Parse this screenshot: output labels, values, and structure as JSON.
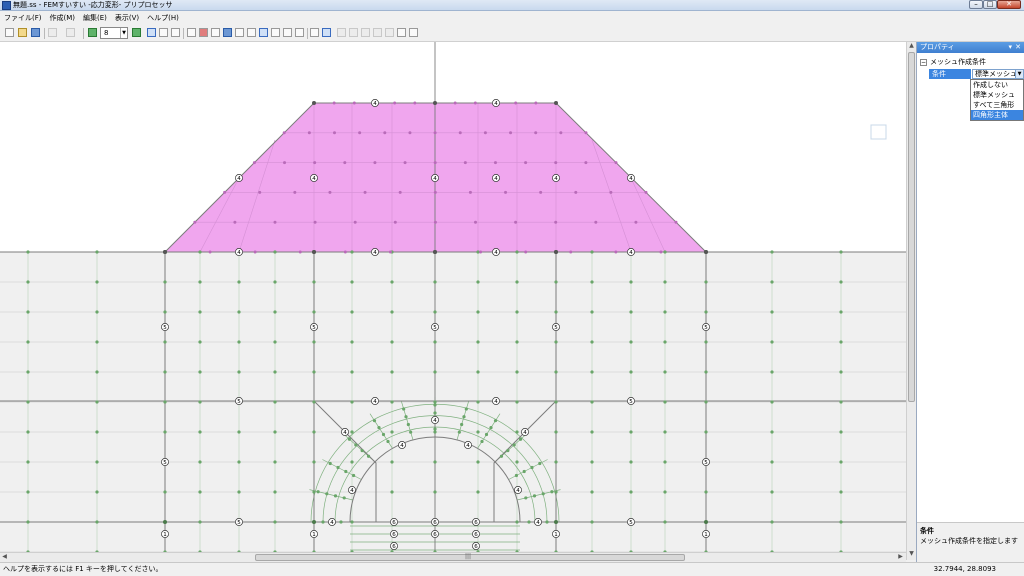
{
  "window": {
    "title": "無題.ss - FEMすいすい -応力変形- プリプロセッサ",
    "min_icon": "minimize-icon",
    "max_icon": "maximize-icon",
    "close_icon": "close-icon"
  },
  "menu": [
    "ファイル(F)",
    "作成(M)",
    "編集(E)",
    "表示(V)",
    "ヘルプ(H)"
  ],
  "toolbar": {
    "step_value": "8"
  },
  "properties": {
    "title": "プロパティ",
    "group_label": "メッシュ作成条件",
    "row_name": "条件",
    "row_value": "標準メッシュ",
    "options": [
      "作成しない",
      "標準メッシュ",
      "すべて三角形",
      "四角形主体"
    ],
    "selected_option": "四角形主体",
    "description_title": "条件",
    "description_text": "メッシュ作成条件を指定します"
  },
  "status": {
    "message": "ヘルプを表示するには F1 キーを押してください。",
    "coordinates": "32.7944, 28.8093"
  },
  "mesh": {
    "labels": {
      "top_row": "4",
      "embankment_mid": "4",
      "ground_row": "4",
      "side_label": "5",
      "ring_label": "4",
      "inner_label": "6",
      "bottom_label": "1"
    },
    "colors": {
      "embankment": "#f0a6ee",
      "ground": "#f0f0f0",
      "mesh_line": "#7fb07f",
      "node": "#6aa66a",
      "outline": "#7c7c7c"
    }
  }
}
